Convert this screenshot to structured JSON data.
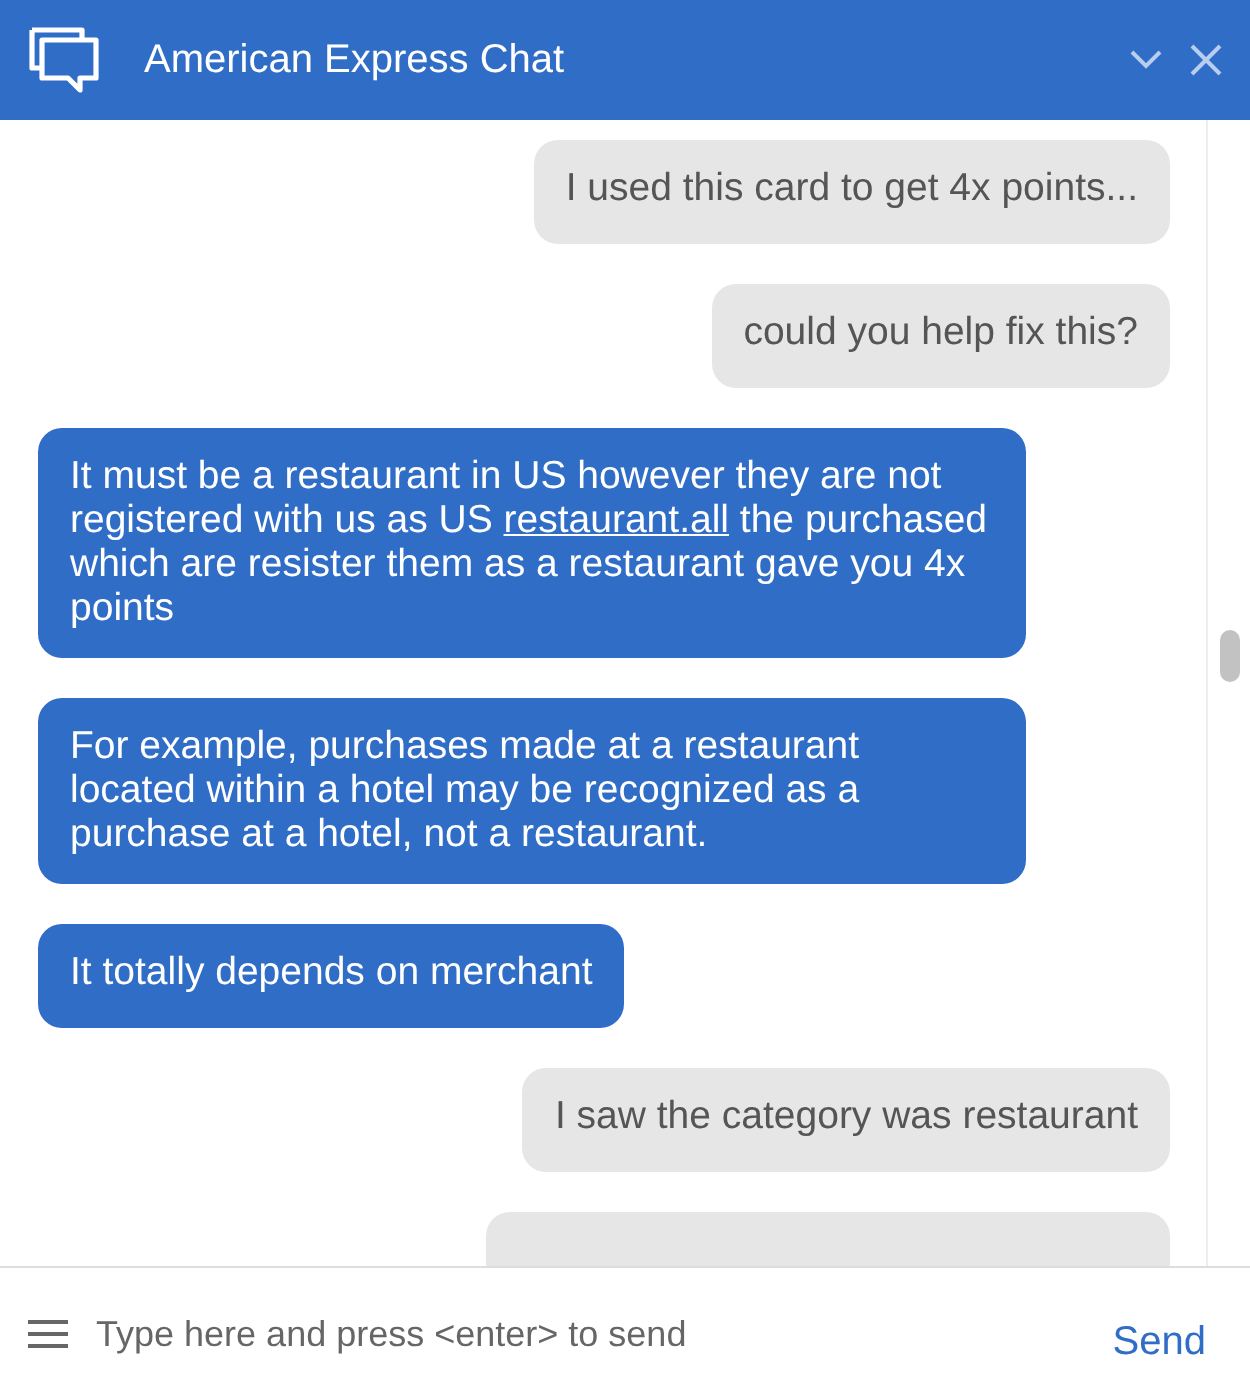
{
  "window": {
    "title": "American Express Chat"
  },
  "messages": [
    {
      "kind": "user",
      "parts": [
        {
          "text": "I used this card to get 4x points..."
        }
      ]
    },
    {
      "kind": "user",
      "parts": [
        {
          "text": "could you help fix this?"
        }
      ]
    },
    {
      "kind": "agent",
      "parts": [
        {
          "text": "It must be a restaurant in US however they are not registered with us as US "
        },
        {
          "link": "restaurant.all"
        },
        {
          "text": " the purchased which are resister them as a restaurant gave you 4x points"
        }
      ]
    },
    {
      "kind": "agent",
      "parts": [
        {
          "text": "For example, purchases made at a restaurant located within a hotel may be recognized as a purchase at a hotel, not a restaurant."
        }
      ]
    },
    {
      "kind": "agent",
      "parts": [
        {
          "text": "It totally depends on merchant"
        }
      ]
    },
    {
      "kind": "user",
      "parts": [
        {
          "text": "I saw the category was restaurant"
        }
      ]
    },
    {
      "kind": "user"
    }
  ],
  "composer": {
    "placeholder": "Type here and press <enter> to send",
    "send": "Send"
  }
}
